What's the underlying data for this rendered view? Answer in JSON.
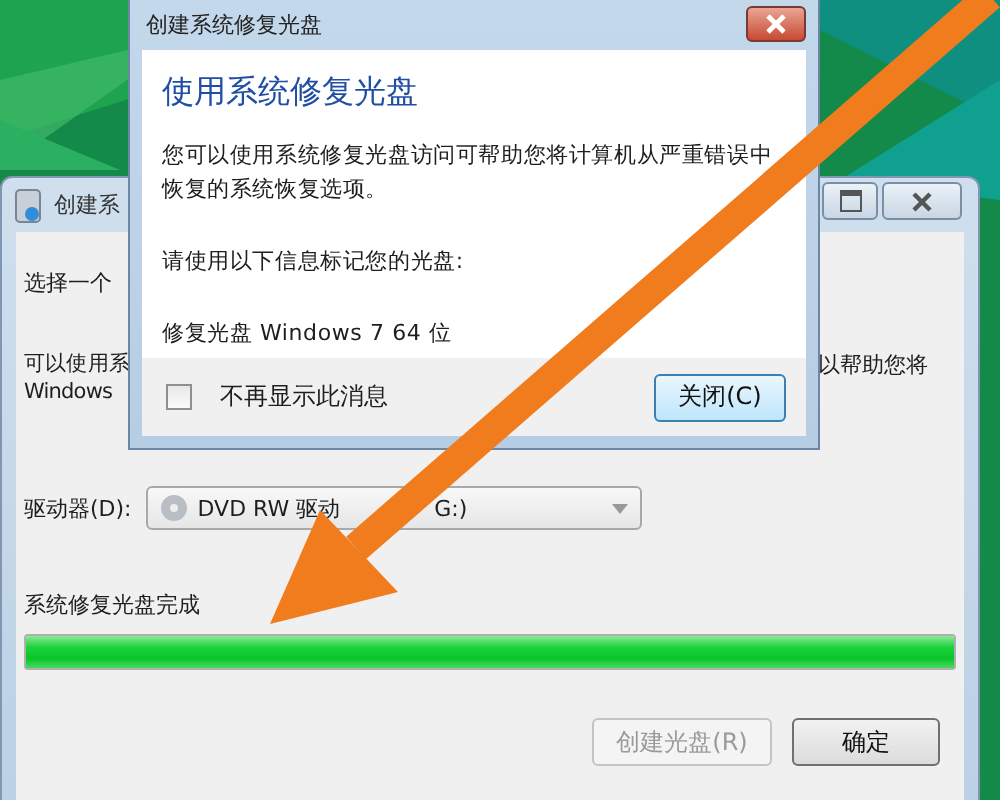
{
  "background_window": {
    "title": "创建系",
    "prompt": "选择一个",
    "text_left": [
      "可以使用系",
      "Windows"
    ],
    "text_right": "以帮助您将",
    "drive_label": "驱动器(D):",
    "drive_value": "DVD RW 驱动",
    "drive_value_end": "G:)",
    "progress_label": "系统修复光盘完成",
    "progress": {
      "level": 1
    },
    "buttons": [
      {
        "label": "创建光盘(R)",
        "disabled": true
      },
      {
        "label": "确定",
        "disabled": false
      }
    ]
  },
  "dialog": {
    "title": "创建系统修复光盘",
    "heading": "使用系统修复光盘",
    "body": "您可以使用系统修复光盘访问可帮助您将计算机从严重错误中恢复的系统恢复选项。",
    "instruction": "请使用以下信息标记您的光盘:",
    "disc_label": "修复光盘 Windows 7 64 位",
    "checkbox": {
      "label": "不再显示此消息",
      "checked": false
    },
    "close_button": "关闭(C)"
  }
}
